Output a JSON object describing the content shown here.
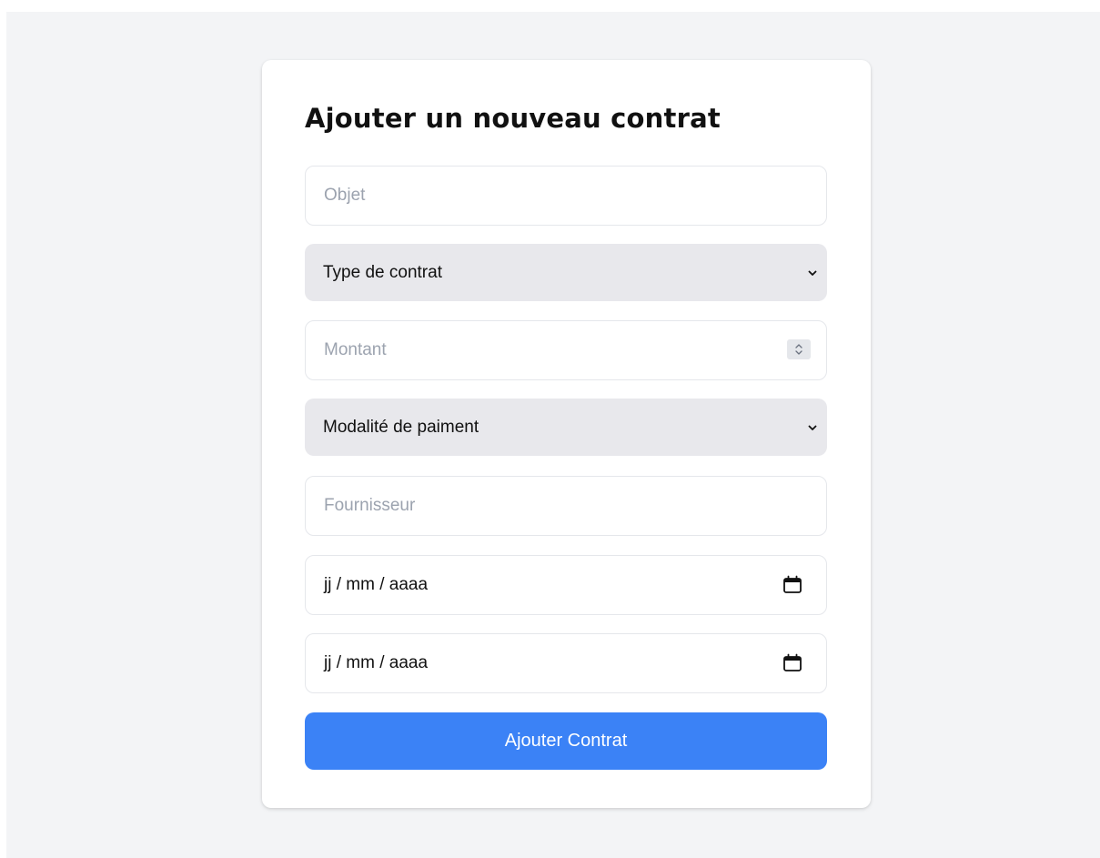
{
  "form": {
    "title": "Ajouter un nouveau contrat",
    "objet": {
      "placeholder": "Objet",
      "value": ""
    },
    "type_contrat": {
      "selected": "Type de contrat",
      "icon": "chevron-down-icon"
    },
    "montant": {
      "placeholder": "Montant",
      "value": "",
      "icon": "stepper-icon"
    },
    "modalite_paiement": {
      "selected": "Modalité de paiment",
      "icon": "chevron-down-icon"
    },
    "fournisseur": {
      "placeholder": "Fournisseur",
      "value": ""
    },
    "date_debut": {
      "display": "jj / mm / aaaa",
      "icon": "calendar-icon"
    },
    "date_fin": {
      "display": "jj / mm / aaaa",
      "icon": "calendar-icon"
    },
    "submit_label": "Ajouter Contrat"
  },
  "colors": {
    "page_background": "#f3f4f6",
    "card_background": "#ffffff",
    "select_background": "#e8e8ec",
    "primary_button": "#3b82f6",
    "placeholder_text": "#9ca3af",
    "border": "#e5e7eb"
  }
}
